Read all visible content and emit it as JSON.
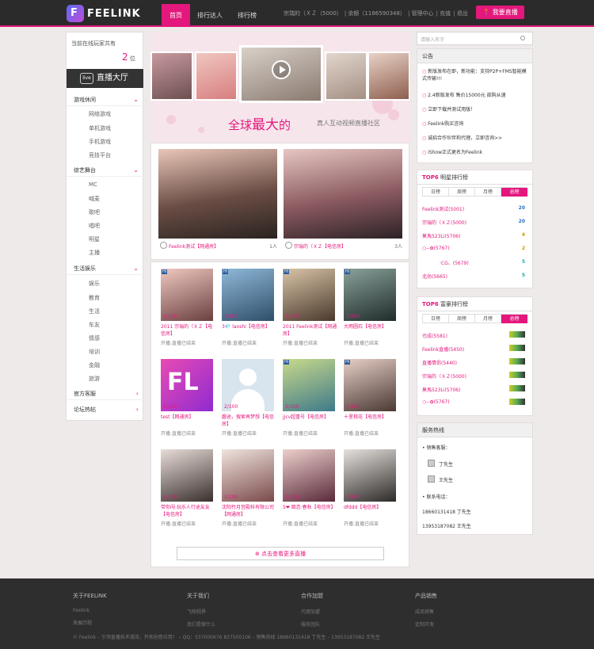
{
  "header": {
    "logo_text": "FEELINK",
    "nav": [
      "首页",
      "排行达人",
      "排行榜"
    ],
    "user_links": [
      "宗瑞的（ＸＺ（5000）",
      "余额（1186590348）",
      "管理中心",
      "充值",
      "退出"
    ],
    "live_button": "我要直播",
    "accent": "#e4177c"
  },
  "sidebar": {
    "online_label": "当前在线玩家共有",
    "online_count": "2",
    "online_unit": "位",
    "hall_tv": "live",
    "hall_label": "直播大厅",
    "groups": [
      {
        "label": "游戏休闲",
        "items": [
          "网络游戏",
          "单机游戏",
          "手机游戏",
          "竞技平台"
        ]
      },
      {
        "label": "综艺舞台",
        "items": [
          "MC",
          "喊麦",
          "歌吧",
          "唱吧",
          "明星",
          "主播"
        ]
      },
      {
        "label": "生活娱乐",
        "items": [
          "娱乐",
          "教育",
          "生活",
          "车友",
          "情感",
          "培训",
          "金融",
          "旅游"
        ]
      },
      {
        "label": "官方客服",
        "items": []
      },
      {
        "label": "论坛热帖",
        "items": []
      }
    ]
  },
  "banner": {
    "slogan_prefix": "全球",
    "slogan_big": "最大",
    "slogan_suffix": "的",
    "slogan_sub": "真人互动视频直播社区"
  },
  "featured": [
    {
      "caption": "Feelink测试【网通房】",
      "viewers": "1人"
    },
    {
      "caption": "宗瑞的（ＸＺ【电信房】",
      "viewers": "3人"
    }
  ],
  "rooms": [
    {
      "name": "2011 宗瑞的（ＸＺ【电信房】",
      "status": "开播:直播已结束",
      "num": "2/100"
    },
    {
      "name": "3💎 laoshi【电信房】",
      "status": "开播:直播已结束",
      "num": "2/100"
    },
    {
      "name": "2011 Feelink测试【网通房】",
      "status": "开播:直播已结束",
      "num": "2/100"
    },
    {
      "name": "大雨圆石【电信房】",
      "status": "开播:直播已结束",
      "num": "1/100"
    },
    {
      "name": "test【网通房】",
      "status": "开播:直播已结束",
      "num": "2/100"
    },
    {
      "name": "趣途，搜索再梦想【电信房】",
      "status": "开播:直播已结束",
      "num": "2/100"
    },
    {
      "name": "jjcv超重号【电信房】",
      "status": "开播:直播已结束",
      "num": "2/100"
    },
    {
      "name": "十里桃花【电信房】",
      "status": "开播:直播已结束",
      "num": "1/100"
    },
    {
      "name": "带你闯·玩乐人行途友友【电信房】",
      "status": "开播:直播已结束",
      "num": "2/100"
    },
    {
      "name": "沈阳竹月宫殿科有限公司【网通房】",
      "status": "开播:直播已结束",
      "num": "2/100"
    },
    {
      "name": "5❤ 暗恋·春秋【电信房】",
      "status": "开播:直播已结束",
      "num": "2/100"
    },
    {
      "name": "dfddd【电信房】",
      "status": "开播:直播已结束",
      "num": "2/100"
    }
  ],
  "more_button": "点击查看更多直播",
  "search": {
    "placeholder": "请输入名字"
  },
  "notice": {
    "title": "公告",
    "items": [
      "新版发布在即，新功能：支持P2P+FMS智能模式传输!!!",
      "2.4新版发布 售价15000元 欲购从速",
      "立即下载并测试用版！",
      "Feelink购买咨询",
      "诚招合作伙伴和代理，立即咨询>>",
      "iShow正式更名为Feelink"
    ]
  },
  "star_rank": {
    "title_prefix": "TOP6",
    "title": "明星排行榜",
    "tabs": [
      "日榜",
      "周榜",
      "月榜",
      "总榜"
    ],
    "rows": [
      {
        "name": "Feelink测试(5001)",
        "lv": "20"
      },
      {
        "name": "宗瑞的（ＸＺ(5000)",
        "lv": "20"
      },
      {
        "name": "莫馬523Li(5706)",
        "lv": "4"
      },
      {
        "name": "○--✿(5767)",
        "lv": "2"
      },
      {
        "name": "·CG、(5679)",
        "lv": "5"
      },
      {
        "name": "北尚(5665)",
        "lv": "5"
      }
    ]
  },
  "rich_rank": {
    "title_prefix": "TOP6",
    "title": "富豪排行榜",
    "tabs": [
      "日榜",
      "周榜",
      "月榜",
      "总榜"
    ],
    "rows": [
      {
        "name": "也成(5581)"
      },
      {
        "name": "Feelink直播(5450)"
      },
      {
        "name": "直播情侣(5440)"
      },
      {
        "name": "宗瑞的（ＸＺ(5000)"
      },
      {
        "name": "莫馬523Li(5706)"
      },
      {
        "name": "○--✿(5767)"
      }
    ]
  },
  "service": {
    "title": "服务热线",
    "sales_label": "销售客服：",
    "agents": [
      "丁先生",
      "王先生"
    ],
    "phone_label": "联系电话：",
    "phones": [
      "18660131418 丁先生",
      "13953187082 王先生"
    ]
  },
  "footer": {
    "cols": [
      {
        "head": "关于FEELINK",
        "items": [
          "Feelink",
          "发展历程"
        ]
      },
      {
        "head": "关于我们",
        "items": [
          "飞翔视界",
          "我们是做什么"
        ]
      },
      {
        "head": "合作加盟",
        "items": [
          "代理加盟",
          "服务团队"
        ]
      },
      {
        "head": "产品销售",
        "items": [
          "成品销售",
          "定制开发"
        ]
      }
    ],
    "copyright": "© Feelink – 引领直播技术潮流，开拓创意应用！ – QQ：537000676 837500106 – 销售热线 18660131418 丁先生 – 13953187082 王先生"
  }
}
